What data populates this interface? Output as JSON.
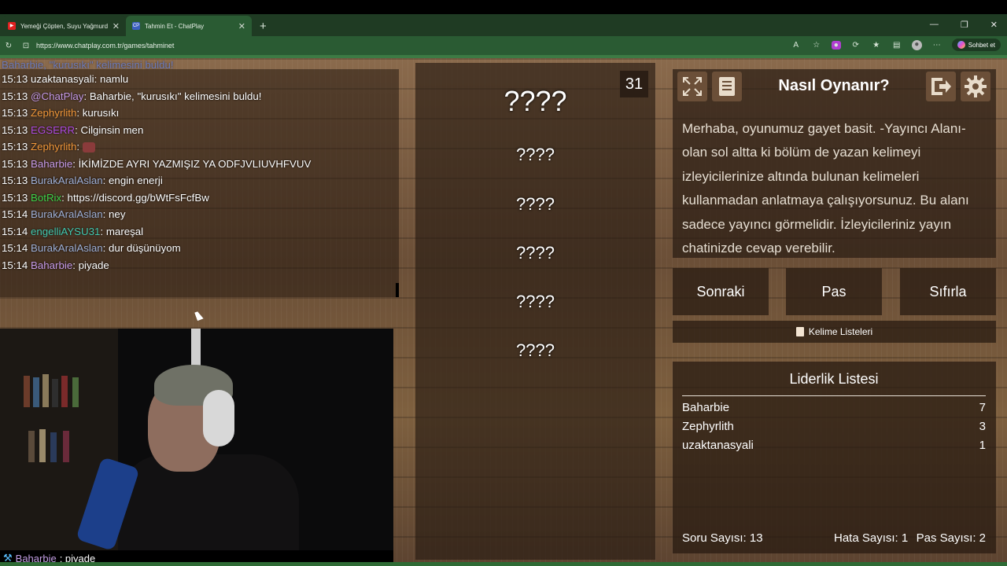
{
  "browser": {
    "tabs": [
      {
        "title": "Yemeği Çöpten, Suyu Yağmurdan,",
        "icon": "youtube-icon",
        "active": false
      },
      {
        "title": "Tahmin Et - ChatPlay",
        "icon": "chatplay-icon",
        "active": true
      }
    ],
    "favicon_text": "CP",
    "url": "https://www.chatplay.com.tr/games/tahminet",
    "sohbet_label": "Sohbet et"
  },
  "chat": {
    "faded_line": "Baharbie, \"kurusıkı\" kelimesini buldu!",
    "messages": [
      {
        "time": "15:13",
        "user": "uzaktanasyali",
        "text": ": namlu",
        "color": "#ffffff"
      },
      {
        "time": "15:13",
        "user": "@ChatPlay",
        "text": ": Baharbie, \"kurusıkı\" kelimesini buldu!",
        "color": "#c79be8"
      },
      {
        "time": "15:13",
        "user": "Zephyrlith",
        "text": ": kurusıkı",
        "color": "#f59a3b"
      },
      {
        "time": "15:13",
        "user": "EGSERR",
        "text": ": Cilginsin men",
        "color": "#b04ce0"
      },
      {
        "time": "15:13",
        "user": "Zephyrlith",
        "text": ": ",
        "color": "#f59a3b"
      },
      {
        "time": "15:13",
        "user": "Baharbie",
        "text": ": İKİMİZDE AYRI YAZMIŞIZ YA ODFJVLIUVHFVUV",
        "color": "#c79be8"
      },
      {
        "time": "15:13",
        "user": "BurakAralAslan",
        "text": ": engin enerji",
        "color": "#9fb0d6"
      },
      {
        "time": "15:13",
        "user": "BotRix",
        "text": ": https://discord.gg/bWtFsFcfBw",
        "color": "#3fd34a"
      },
      {
        "time": "15:14",
        "user": "BurakAralAslan",
        "text": ": ney",
        "color": "#9fb0d6"
      },
      {
        "time": "15:14",
        "user": "engelliAYSU31",
        "text": ": mareşal",
        "color": "#44c9b0"
      },
      {
        "time": "15:14",
        "user": "BurakAralAslan",
        "text": ": dur düşünüyom",
        "color": "#9fb0d6"
      },
      {
        "time": "15:14",
        "user": "Baharbie",
        "text": ": piyade",
        "color": "#c79be8"
      }
    ]
  },
  "overlay_chat": {
    "user": "Baharbie",
    "text": ": piyade"
  },
  "game": {
    "timer": "31",
    "main_word": "????",
    "hidden_words": [
      "????",
      "????",
      "????",
      "????",
      "????"
    ]
  },
  "howto": {
    "title": "Nasıl Oynanır?",
    "text": "Merhaba, oyunumuz gayet basit. -Yayıncı Alanı- olan sol altta ki bölüm de yazan kelimeyi izleyicilerinize altında bulunan kelimeleri kullanmadan anlatmaya çalışıyorsunuz. Bu alanı sadece yayıncı görmelidir. İzleyicileriniz yayın chatinizde cevap verebilir."
  },
  "actions": {
    "next": "Sonraki",
    "pass": "Pas",
    "reset": "Sıfırla",
    "word_lists": "Kelime Listeleri"
  },
  "leaderboard": {
    "title": "Liderlik Listesi",
    "rows": [
      {
        "name": "Baharbie",
        "score": "7"
      },
      {
        "name": "Zephyrlith",
        "score": "3"
      },
      {
        "name": "uzaktanasyali",
        "score": "1"
      }
    ],
    "question_count": "Soru Sayısı: 13",
    "error_count": "Hata Sayısı: 1",
    "pass_count": "Pas Sayısı: 2"
  },
  "colors": {
    "accent": "#2a5b33",
    "wood": "#7a5a3e",
    "panel": "#2b1e15"
  }
}
